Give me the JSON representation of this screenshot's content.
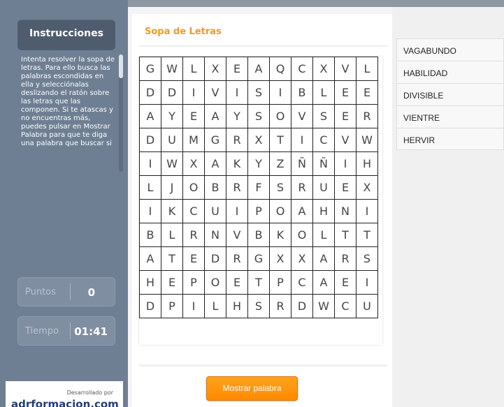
{
  "sidebar": {
    "title": "Instrucciones",
    "instructions": "Intenta resolver la sopa de letras. Para ello busca las palabras escondidas en ella y selecciónalas deslizando el ratón sobre las letras que las componen. Si te atascas y no encuentras más, puedes pulsar en Mostrar Palabra para que te diga una palabra que buscar si",
    "points_label": "Puntos",
    "points_value": "0",
    "time_label": "Tiempo",
    "time_value": "01:41",
    "credits_small": "Desarrollado por",
    "credits_logo": "adrformacion.com"
  },
  "main": {
    "title": "Sopa de Letras",
    "button_label": "Mostrar palabra",
    "grid": [
      [
        "G",
        "W",
        "L",
        "X",
        "E",
        "A",
        "Q",
        "C",
        "X",
        "V",
        "L"
      ],
      [
        "D",
        "D",
        "I",
        "V",
        "I",
        "S",
        "I",
        "B",
        "L",
        "E",
        "E"
      ],
      [
        "A",
        "Y",
        "E",
        "A",
        "Y",
        "S",
        "O",
        "V",
        "S",
        "E",
        "R"
      ],
      [
        "D",
        "U",
        "M",
        "G",
        "R",
        "X",
        "T",
        "I",
        "C",
        "V",
        "W"
      ],
      [
        "I",
        "W",
        "X",
        "A",
        "K",
        "Y",
        "Z",
        "Ñ",
        "Ñ",
        "I",
        "H"
      ],
      [
        "L",
        "J",
        "O",
        "B",
        "R",
        "F",
        "S",
        "R",
        "U",
        "E",
        "X"
      ],
      [
        "I",
        "K",
        "C",
        "U",
        "I",
        "P",
        "O",
        "A",
        "H",
        "N",
        "I"
      ],
      [
        "B",
        "L",
        "R",
        "N",
        "V",
        "B",
        "K",
        "O",
        "L",
        "T",
        "T"
      ],
      [
        "A",
        "T",
        "E",
        "D",
        "R",
        "G",
        "X",
        "X",
        "A",
        "R",
        "S"
      ],
      [
        "H",
        "E",
        "P",
        "O",
        "E",
        "T",
        "P",
        "C",
        "A",
        "E",
        "I"
      ],
      [
        "D",
        "P",
        "I",
        "L",
        "H",
        "S",
        "R",
        "D",
        "W",
        "C",
        "U"
      ]
    ]
  },
  "words": [
    "VAGABUNDO",
    "HABILIDAD",
    "DIVISIBLE",
    "VIENTRE",
    "HERVIR"
  ]
}
